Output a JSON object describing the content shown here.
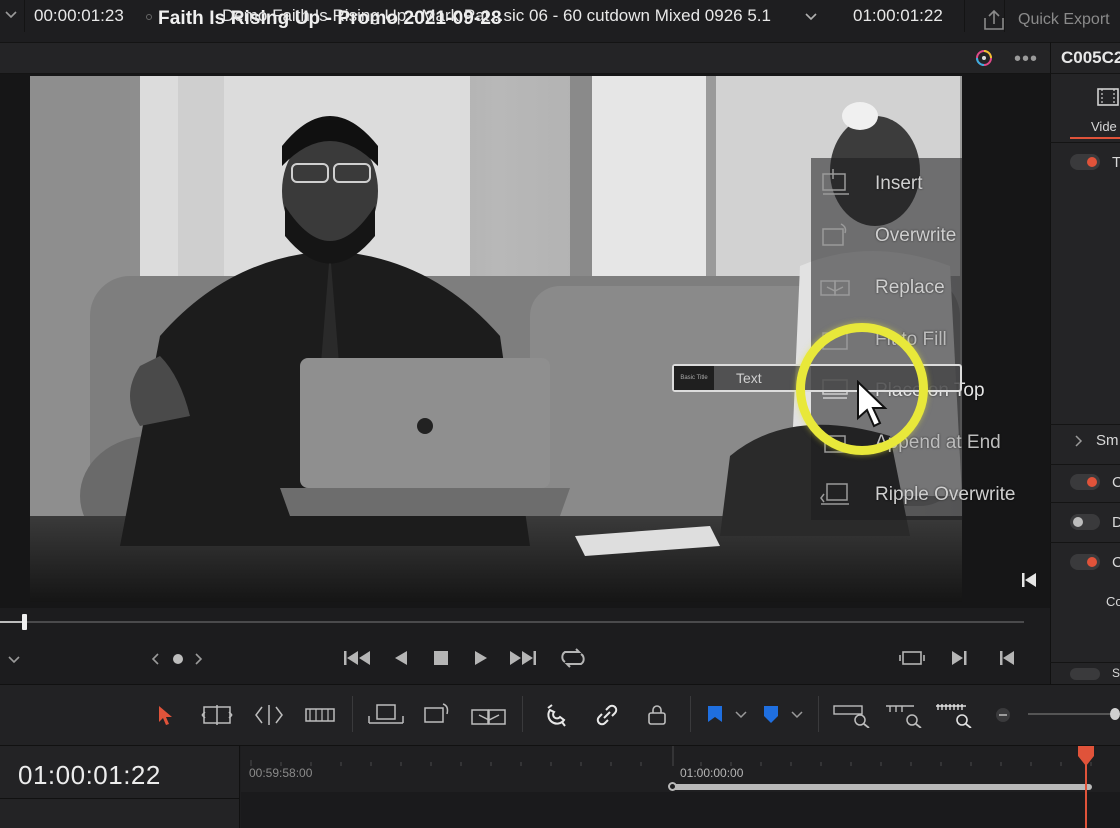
{
  "title": "Faith Is Rising Up - Promo 2021-09-28",
  "quick_export": "Quick Export",
  "viewer": {
    "source_timecode": "00:00:01:23",
    "clip_name": "Demo Faith Is Rising Up - Mark Pat...sic 06 - 60 cutdown Mixed 0926 5.1",
    "record_timecode": "01:00:01:22"
  },
  "inspector": {
    "clip_id": "C005C2",
    "tab_label": "Vide",
    "rows": [
      {
        "letter": "T",
        "on": true
      },
      {
        "letter": "Sm",
        "expand": true
      },
      {
        "letter": "C",
        "on": true
      },
      {
        "letter": "D",
        "on": false
      },
      {
        "letter": "C",
        "on": true
      },
      {
        "letter": "Co",
        "sub": true
      },
      {
        "letter": "S",
        "on": true
      }
    ]
  },
  "edit_overlay": {
    "items": [
      "Insert",
      "Overwrite",
      "Replace",
      "Fit to Fill",
      "Place on Top",
      "Append at End",
      "Ripple Overwrite"
    ],
    "dragged_clip_thumb": "Basic Title",
    "dragged_clip_label": "Text"
  },
  "timeline": {
    "timecode": "01:00:01:22",
    "ruler_labels": [
      "00:59:58:00",
      "01:00:00:00"
    ]
  },
  "colors": {
    "accent_red": "#e0533a",
    "highlight_yellow": "#e8e83a",
    "marker_blue": "#1f6fe0"
  }
}
